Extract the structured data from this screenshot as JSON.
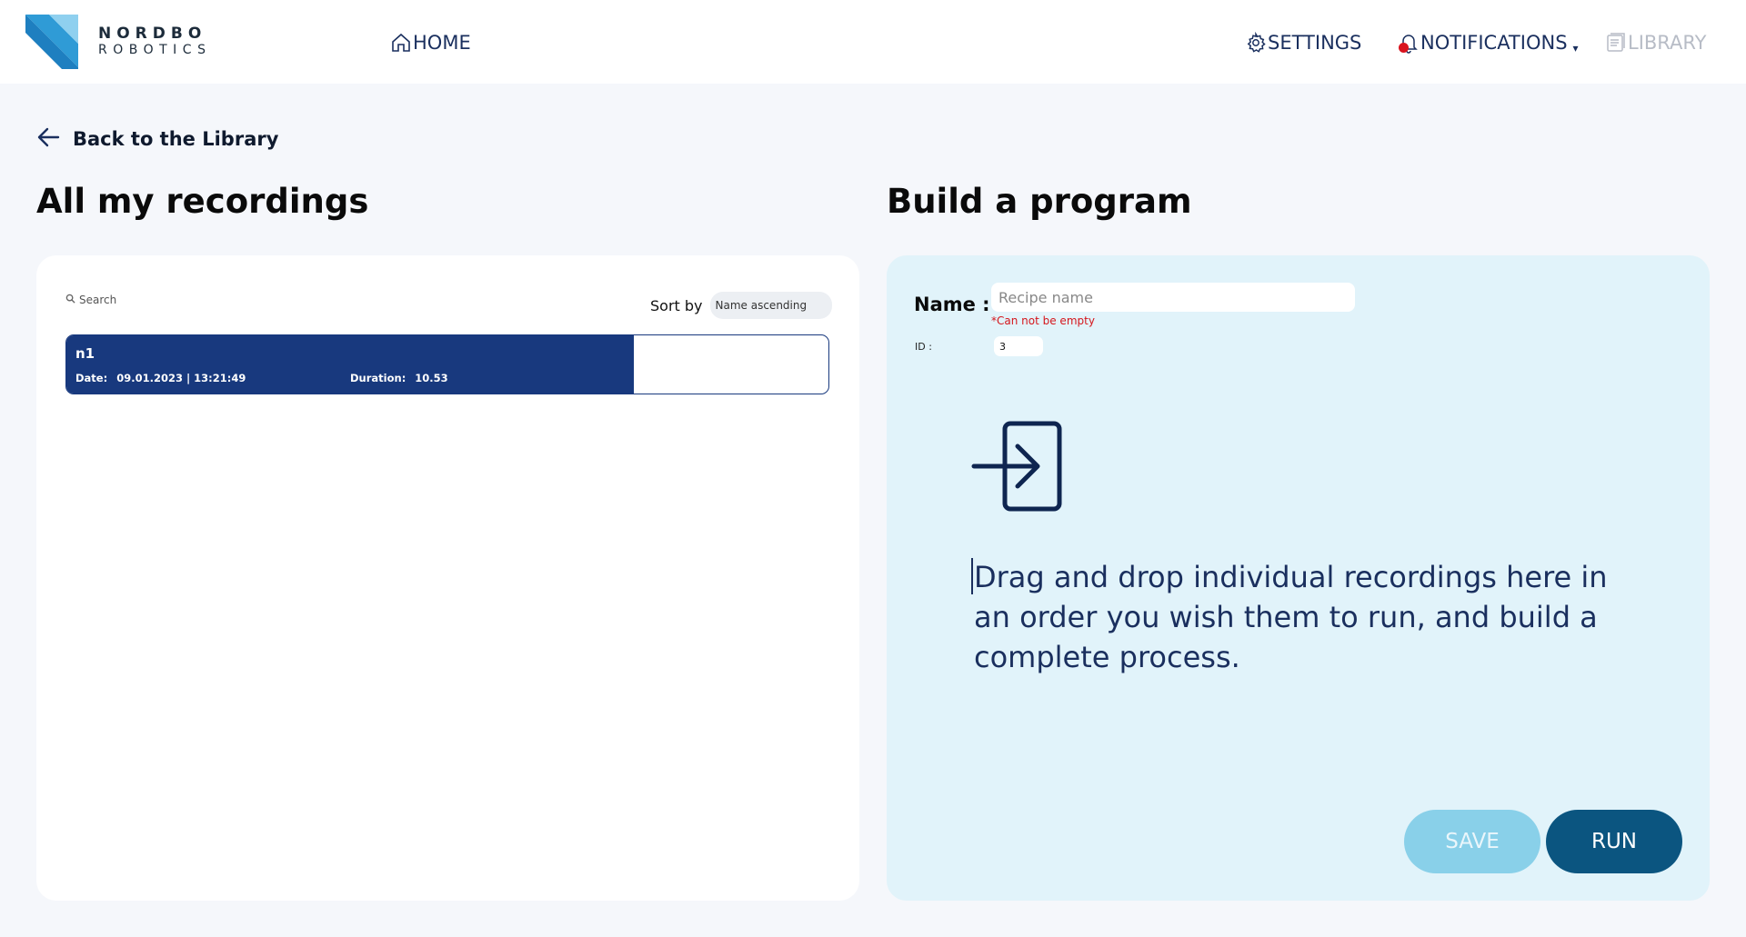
{
  "header": {
    "logo_line1": "NORDBO",
    "logo_line2": "ROBOTICS",
    "nav": {
      "home": "HOME",
      "settings": "SETTINGS",
      "notifications": "NOTIFICATIONS",
      "library": "LIBRARY"
    },
    "icons": {
      "home": "home-icon",
      "settings": "gear-icon",
      "notifications": "bell-icon",
      "library": "library-icon"
    }
  },
  "back_link": "Back to the Library",
  "left": {
    "title": "All my recordings",
    "search_placeholder": "Search",
    "sort_label": "Sort by",
    "sort_value": "Name ascending",
    "recordings": [
      {
        "name": "n1",
        "date_label": "Date:",
        "date_value": "09.01.2023 | 13:21:49",
        "duration_label": "Duration:",
        "duration_value": "10.53"
      }
    ]
  },
  "right": {
    "title": "Build a program",
    "name_label": "Name :",
    "name_placeholder": "Recipe name",
    "name_value": "",
    "error": "*Can not be empty",
    "id_label": "ID :",
    "id_value": "3",
    "drop_text": "Drag and drop individual recordings here in an order you wish them to run, and build a complete process.",
    "save_label": "SAVE",
    "run_label": "RUN"
  },
  "colors": {
    "brand_dark": "#18397e",
    "accent_light": "#89d0e9",
    "run_button": "#0b5580",
    "panel_right": "#e1f3fa",
    "error": "#d5161c"
  }
}
